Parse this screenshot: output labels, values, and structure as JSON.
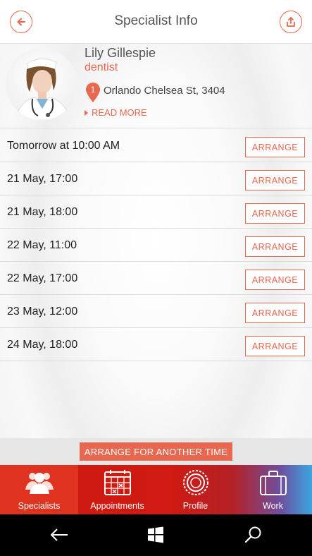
{
  "header": {
    "title": "Specialist Info"
  },
  "specialist": {
    "name": "Lily Gillespie",
    "role": "dentist",
    "location_badge": "1",
    "address": "Orlando Chelsea St, 3404",
    "read_more": "READ MORE"
  },
  "slots": [
    {
      "time": "Tomorrow at 10:00 AM",
      "action": "ARRANGE"
    },
    {
      "time": "21 May, 17:00",
      "action": "ARRANGE"
    },
    {
      "time": "21 May, 18:00",
      "action": "ARRANGE"
    },
    {
      "time": "22 May, 11:00",
      "action": "ARRANGE"
    },
    {
      "time": "22 May, 17:00",
      "action": "ARRANGE"
    },
    {
      "time": "23 May, 12:00",
      "action": "ARRANGE"
    },
    {
      "time": "24 May, 18:00",
      "action": "ARRANGE"
    }
  ],
  "arrange_another": "ARRANGE FOR ANOTHER TIME",
  "tabs": [
    {
      "label": "Specialists",
      "icon": "people-icon",
      "active": true
    },
    {
      "label": "Appointments",
      "icon": "calendar-icon",
      "active": false
    },
    {
      "label": "Profile",
      "icon": "gear-icon",
      "active": false
    },
    {
      "label": "Work",
      "icon": "briefcase-icon",
      "active": false
    }
  ],
  "colors": {
    "accent": "#e8674f",
    "tabbar_red": "#cc1a10",
    "tabbar_active": "#e0331f",
    "tabbar_blue": "#3aa6e0"
  }
}
